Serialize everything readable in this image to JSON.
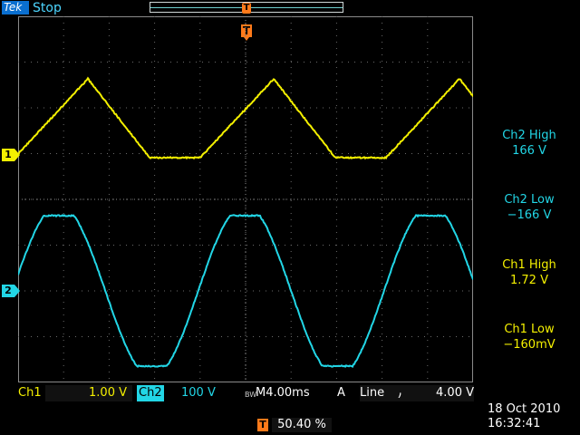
{
  "brand": {
    "logo_text": "Tek"
  },
  "acq_state": "Stop",
  "trigger_marker": "T",
  "channels": {
    "ch1": {
      "marker": "1",
      "label": "Ch1",
      "scale": "1.00 V",
      "color": "#f4f000"
    },
    "ch2": {
      "marker": "2",
      "label": "Ch2",
      "scale": "100 V",
      "color": "#22d6e6"
    }
  },
  "measurements": [
    {
      "name": "Ch2 High",
      "value": "166 V"
    },
    {
      "name": "Ch2 Low",
      "value": "−166 V"
    },
    {
      "name": "Ch1 High",
      "value": "1.72 V"
    },
    {
      "name": "Ch1 Low",
      "value": "−160mV"
    }
  ],
  "timebase": {
    "bw_mark": "BW",
    "label": "M4.00ms"
  },
  "trigger": {
    "source": "A",
    "coupling": "Line",
    "edge_icon": "falling-edge-icon",
    "edge_glyph": "⹜",
    "level": "4.00 V",
    "position": "50.40 %"
  },
  "datetime": {
    "date": "18 Oct  2010",
    "time": "16:32:41"
  }
}
